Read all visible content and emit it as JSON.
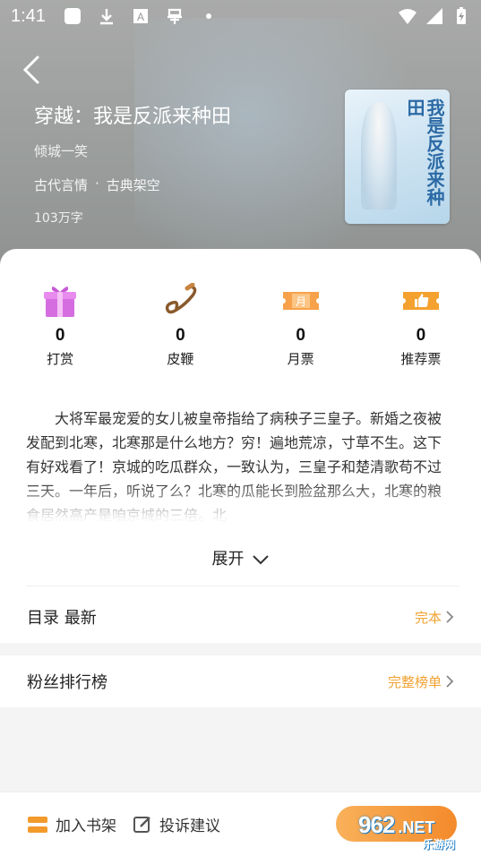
{
  "status_bar": {
    "time": "1:41",
    "icons_left": [
      "app-square-icon",
      "download-icon",
      "a-badge-icon",
      "bug-icon",
      "dot-icon"
    ],
    "icons_right": [
      "wifi-icon",
      "signal-icon",
      "battery-charging-icon"
    ]
  },
  "book": {
    "title": "穿越：我是反派来种田",
    "author": "倾城一笑",
    "tags": [
      "古代言情",
      "·",
      "古典架空"
    ],
    "word_count": "103万字",
    "cover_text": "我是反派来种田"
  },
  "gifts": [
    {
      "label": "打赏",
      "count": "0",
      "icon": "gift-box-icon"
    },
    {
      "label": "皮鞭",
      "count": "0",
      "icon": "whip-icon"
    },
    {
      "label": "月票",
      "count": "0",
      "icon": "month-ticket-icon",
      "badge": "月"
    },
    {
      "label": "推荐票",
      "count": "0",
      "icon": "thumbs-up-ticket-icon"
    }
  ],
  "synopsis": "大将军最宠爱的女儿被皇帝指给了病秧子三皇子。新婚之夜被发配到北寒，北寒那是什么地方？穷！遍地荒凉，寸草不生。这下有好戏看了！京城的吃瓜群众，一致认为，三皇子和楚清歌苟不过三天。一年后，听说了么？北寒的瓜能长到脸盆那么大，北寒的粮食居然高产是咱京城的三倍。北",
  "expand_label": "展开",
  "catalog": {
    "title": "目录 最新",
    "status": "完本"
  },
  "fans": {
    "title": "粉丝排行榜",
    "link": "完整榜单"
  },
  "bottom": {
    "add_shelf": "加入书架",
    "complain": "投诉建议"
  },
  "watermark": {
    "number": "962",
    "suffix": ".NET",
    "sub": "乐游网"
  },
  "colors": {
    "accent": "#f0a233",
    "read_button": "#f5982f"
  }
}
